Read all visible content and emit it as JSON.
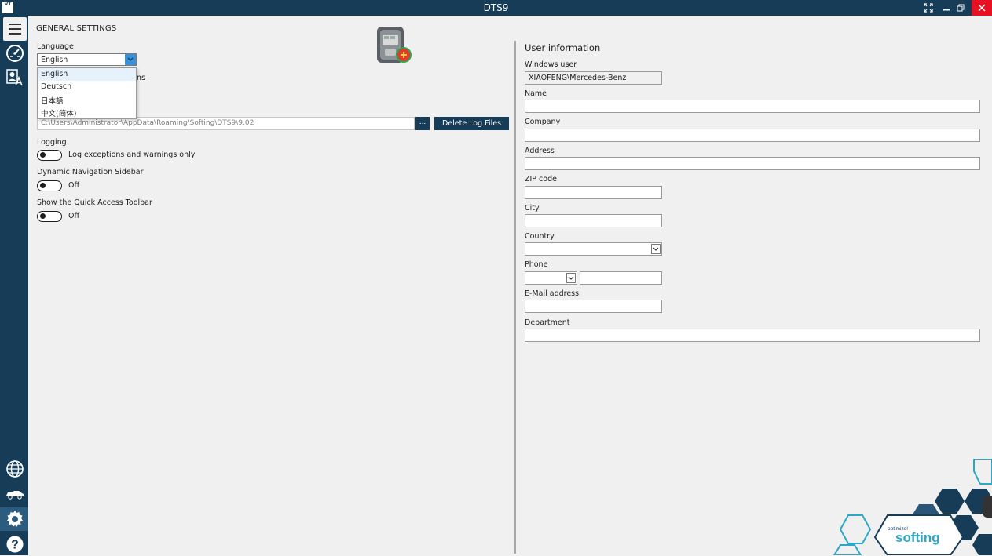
{
  "window": {
    "title": "DTS9",
    "app_icon_text": "VT"
  },
  "titlebar_buttons": [
    "fullscreen-icon",
    "minimize-icon",
    "restore-icon",
    "close-icon"
  ],
  "sidebar": {
    "items": [
      "menu-icon",
      "gauge-icon",
      "person-translate-icon",
      "globe-icon",
      "car-icon",
      "gear-icon",
      "help-icon"
    ],
    "active": "gear-icon",
    "help_glyph": "?"
  },
  "general": {
    "title": "GENERAL SETTINGS",
    "language_label": "Language",
    "language_value": "English",
    "language_options": [
      "English",
      "Deutsch",
      "日本語",
      "中文(简体)"
    ],
    "hidden_partial_text": "ns",
    "log_path": "C:\\Users\\Administrator\\AppData\\Roaming\\Softing\\DTS9\\9.02",
    "browse_label": "...",
    "delete_logs_label": "Delete Log Files",
    "logging_label": "Logging",
    "logging_value": "Log exceptions and warnings only",
    "nav_sidebar_label": "Dynamic Navigation Sidebar",
    "nav_sidebar_value": "Off",
    "quick_access_label": "Show the Quick Access Toolbar",
    "quick_access_value": "Off"
  },
  "user_info": {
    "title": "User information",
    "windows_user_label": "Windows user",
    "windows_user_value": "XIAOFENG\\Mercedes-Benz",
    "name_label": "Name",
    "company_label": "Company",
    "address_label": "Address",
    "zip_label": "ZIP code",
    "city_label": "City",
    "country_label": "Country",
    "phone_label": "Phone",
    "email_label": "E-Mail address",
    "department_label": "Department"
  },
  "branding": {
    "tagline": "optimize!",
    "name": "softing"
  },
  "colors": {
    "sidebar": "#173c57",
    "accent": "#3a8fd9",
    "close": "#e81123",
    "brand_teal": "#2ba8c8"
  }
}
